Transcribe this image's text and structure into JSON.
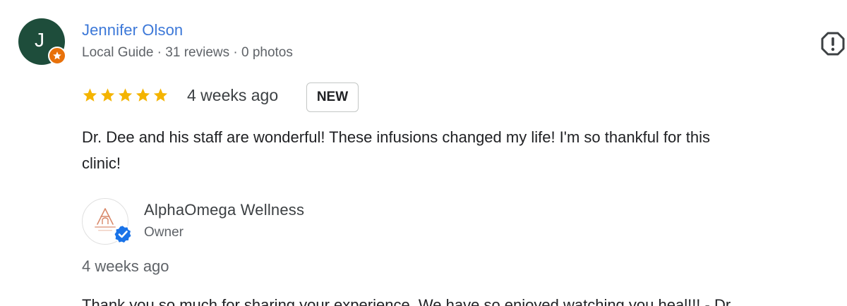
{
  "review": {
    "reviewer": {
      "initial": "J",
      "name": "Jennifer Olson",
      "meta": "Local Guide · 31 reviews · 0 photos",
      "avatar_color": "#1e4d3b",
      "badge_color": "#e8710a"
    },
    "report_icon": "report-flag-icon",
    "rating": 5,
    "star_color": "#f4b400",
    "date": "4 weeks ago",
    "badge": "NEW",
    "text": "Dr. Dee and his staff are wonderful! These infusions changed my life! I'm so thankful for this\nclinic!"
  },
  "owner_reply": {
    "owner_name": "AlphaOmega Wellness",
    "role": "Owner",
    "verified_color": "#1a73e8",
    "date": "4 weeks ago",
    "text": "Thank you so much for sharing your experience. We have so enjoyed watching you heal!!! - Dr"
  }
}
